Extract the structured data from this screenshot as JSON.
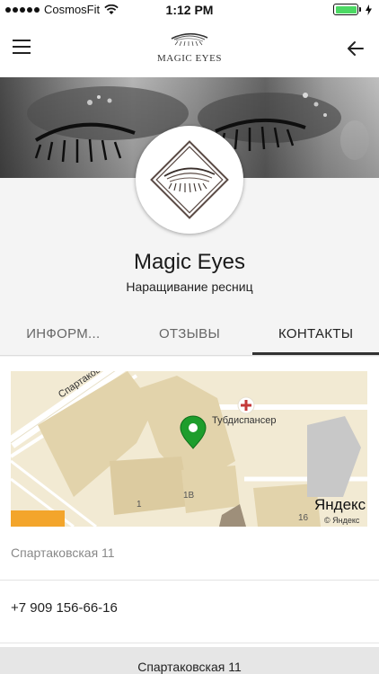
{
  "status_bar": {
    "carrier": "CosmosFit",
    "time": "1:12 PM"
  },
  "navbar": {
    "logo_text": "MAGIC EYES"
  },
  "profile": {
    "name": "Magic Eyes",
    "subtitle": "Наращивание ресниц"
  },
  "tabs": [
    {
      "label": "ИНФОРМ..."
    },
    {
      "label": "ОТЗЫВЫ"
    },
    {
      "label": "КОНТАКТЫ"
    }
  ],
  "map": {
    "street_label": "Спартаковс",
    "poi_label": "Тубдиспансер",
    "house_1": "1",
    "house_1v": "1В",
    "house_16": "16",
    "provider": "Яндекс",
    "provider_small": "© Яндекс"
  },
  "contacts": {
    "address": "Спартаковская 11",
    "phone": "+7 909 156-66-16"
  },
  "footer": {
    "button_label": "Спартаковская 11"
  }
}
